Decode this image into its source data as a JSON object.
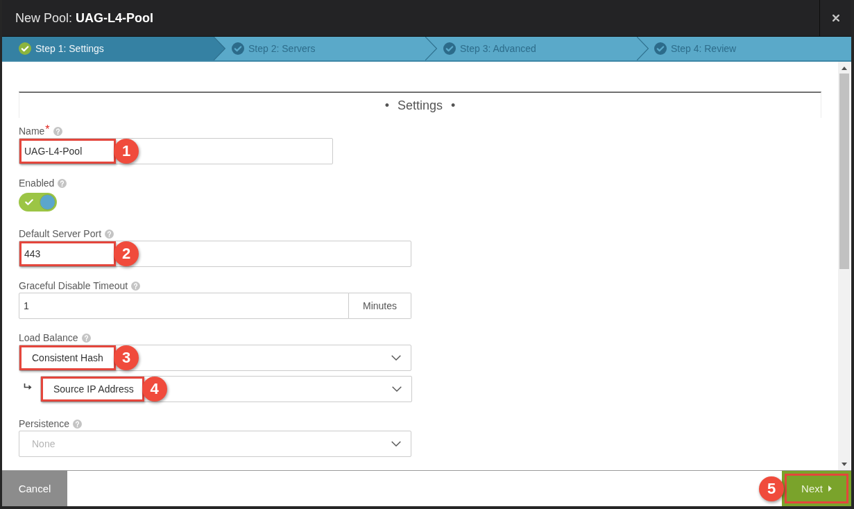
{
  "window": {
    "title": "New Pool: **UAG-L4-Pool**"
  },
  "steps": [
    {
      "label": "Step 1: Settings",
      "selected": true
    },
    {
      "label": "Step 2: Servers",
      "selected": false
    },
    {
      "label": "Step 3: Advanced",
      "selected": false
    },
    {
      "label": "Step 4: Review",
      "selected": false
    }
  ],
  "section": {
    "title": "• Settings •"
  },
  "fields": [
    {
      "kind": "text",
      "label": "Name",
      "required_mark": "*",
      "help": true,
      "value": "UAG-L4-Pool",
      "callout": "1"
    },
    {
      "kind": "toggle",
      "label": "Enabled",
      "help": true,
      "on": true
    },
    {
      "kind": "text",
      "label": "Default Server Port",
      "help": true,
      "value": "443",
      "callout": "2"
    },
    {
      "kind": "addon",
      "label": "Graceful Disable Timeout",
      "help": true,
      "value": "1",
      "unit": "Minutes"
    },
    {
      "kind": "select",
      "label": "Load Balance",
      "help": true,
      "value": "Consistent Hash",
      "callout": "3",
      "sub": {
        "value": "Source IP Address",
        "callout": "4"
      }
    },
    {
      "kind": "select",
      "label": "Persistence",
      "help": true,
      "placeholder": "None"
    }
  ],
  "footer": {
    "cancel": "Cancel",
    "next": "Next",
    "next_callout": "5"
  }
}
